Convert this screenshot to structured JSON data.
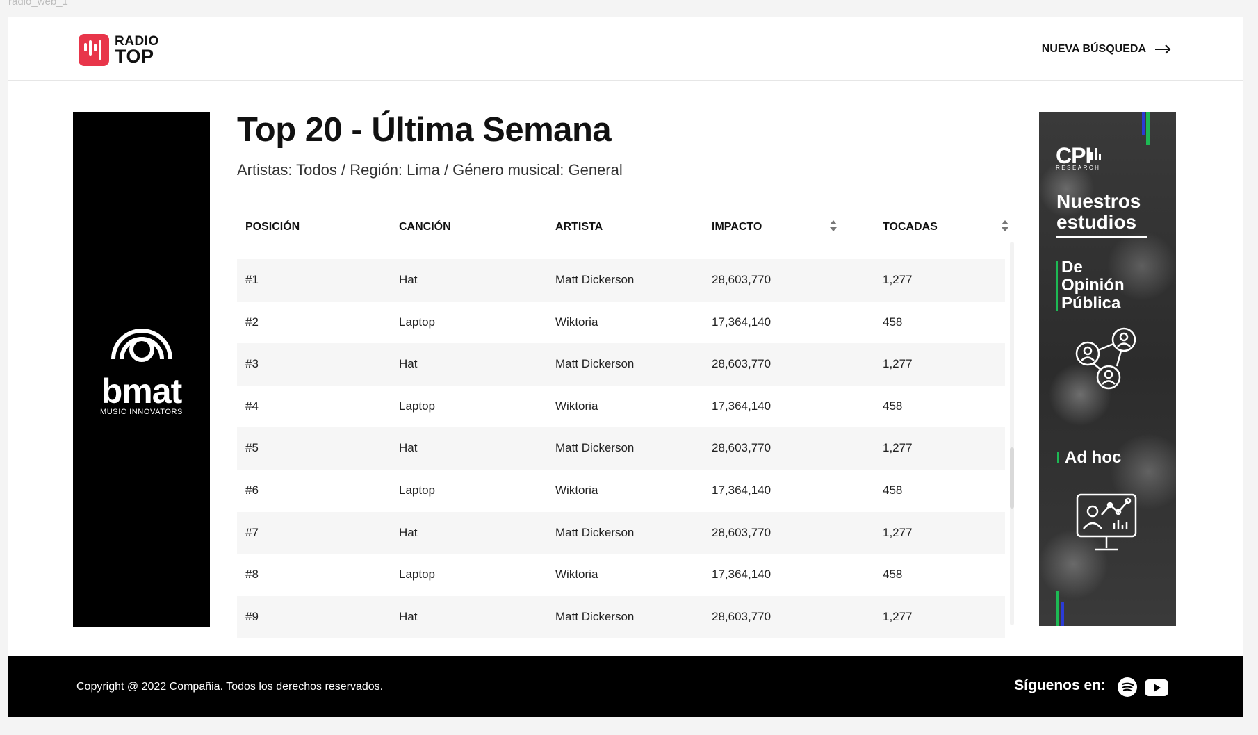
{
  "frame_label": "radio_web_1",
  "header": {
    "logo_line1": "RADIO",
    "logo_line2": "TOP",
    "new_search_label": "NUEVA BÚSQUEDA"
  },
  "left_ad": {
    "brand": "bmat",
    "tagline": "MUSIC INNOVATORS"
  },
  "main": {
    "title": "Top 20 - Última Semana",
    "subtitle": "Artistas: Todos / Región: Lima / Género musical: General",
    "columns": [
      "POSICIÓN",
      "CANCIÓN",
      "ARTISTA",
      "IMPACTO",
      "TOCADAS"
    ],
    "rows": [
      {
        "pos": "#1",
        "song": "Hat",
        "artist": "Matt Dickerson",
        "impact": "28,603,770",
        "plays": "1,277"
      },
      {
        "pos": "#2",
        "song": "Laptop",
        "artist": "Wiktoria",
        "impact": "17,364,140",
        "plays": "458"
      },
      {
        "pos": "#3",
        "song": "Hat",
        "artist": "Matt Dickerson",
        "impact": "28,603,770",
        "plays": "1,277"
      },
      {
        "pos": "#4",
        "song": "Laptop",
        "artist": "Wiktoria",
        "impact": "17,364,140",
        "plays": "458"
      },
      {
        "pos": "#5",
        "song": "Hat",
        "artist": "Matt Dickerson",
        "impact": "28,603,770",
        "plays": "1,277"
      },
      {
        "pos": "#6",
        "song": "Laptop",
        "artist": "Wiktoria",
        "impact": "17,364,140",
        "plays": "458"
      },
      {
        "pos": "#7",
        "song": "Hat",
        "artist": "Matt Dickerson",
        "impact": "28,603,770",
        "plays": "1,277"
      },
      {
        "pos": "#8",
        "song": "Laptop",
        "artist": "Wiktoria",
        "impact": "17,364,140",
        "plays": "458"
      },
      {
        "pos": "#9",
        "song": "Hat",
        "artist": "Matt Dickerson",
        "impact": "28,603,770",
        "plays": "1,277"
      }
    ]
  },
  "right_ad": {
    "logo": "CPI",
    "logo_sub": "RESEARCH",
    "heading": "Nuestros estudios",
    "item1": "De Opinión Pública",
    "item2": "Ad hoc"
  },
  "footer": {
    "copyright": "Copyright @ 2022 Compañia. Todos los derechos reservados.",
    "follow_label": "Síguenos en:",
    "social_icons": [
      "spotify-icon",
      "youtube-icon"
    ]
  },
  "colors": {
    "brand_red": "#e8354a",
    "ad_green": "#1db954",
    "ad_blue": "#2b3bd6"
  }
}
